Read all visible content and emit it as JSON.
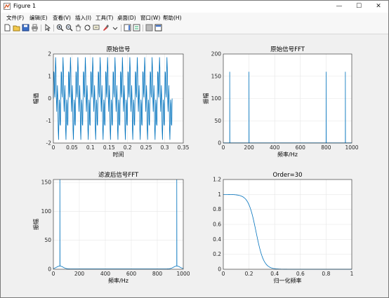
{
  "window": {
    "title": "Figure 1",
    "minimize": "—",
    "maximize": "☐",
    "close": "✕"
  },
  "menu": [
    "文件(F)",
    "编辑(E)",
    "查看(V)",
    "插入(I)",
    "工具(T)",
    "桌面(D)",
    "窗口(W)",
    "帮助(H)"
  ],
  "toolbar": {
    "icons": [
      "new-figure-icon",
      "open-file-icon",
      "save-icon",
      "print-icon",
      "pointer-icon",
      "zoom-in-icon",
      "zoom-out-icon",
      "pan-icon",
      "rotate-3d-icon",
      "data-cursor-icon",
      "brush-icon",
      "link-plot-icon",
      "insert-colorbar-icon",
      "insert-legend-icon",
      "hide-plot-tools-icon",
      "show-plot-tools-icon"
    ]
  },
  "colors": {
    "line": "#0072bd",
    "grid": "#e6e6e6",
    "axes": "#262626"
  },
  "chart_data": [
    {
      "type": "line",
      "title": "原始信号",
      "xlabel": "时间",
      "ylabel": "幅值",
      "xlim": [
        0,
        0.35
      ],
      "ylim": [
        -2,
        2
      ],
      "xticks": [
        "0",
        "0.05",
        "0.1",
        "0.15",
        "0.2",
        "0.25",
        "0.3",
        "0.35"
      ],
      "yticks": [
        "-2",
        "-1",
        "0",
        "1",
        "2"
      ],
      "series": [
        {
          "description": "sum of 50 Hz and 200 Hz sinusoids, sampled 1000 Hz, duration ~0.32 s",
          "x_end": 0.32,
          "amplitude_max": 1.9
        }
      ],
      "grid": true
    },
    {
      "type": "line",
      "title": "原始信号FFT",
      "xlabel": "频率/Hz",
      "ylabel": "振幅",
      "xlim": [
        0,
        1000
      ],
      "ylim": [
        0,
        200
      ],
      "xticks": [
        "0",
        "200",
        "400",
        "600",
        "800",
        "1000"
      ],
      "yticks": [
        "0",
        "50",
        "100",
        "150",
        "200"
      ],
      "peaks": [
        {
          "x": 50,
          "y": 160
        },
        {
          "x": 200,
          "y": 160
        },
        {
          "x": 800,
          "y": 160
        },
        {
          "x": 950,
          "y": 160
        }
      ],
      "grid": true
    },
    {
      "type": "line",
      "title": "滤波后信号FFT",
      "xlabel": "频率/Hz",
      "ylabel": "振幅",
      "xlim": [
        0,
        1000
      ],
      "ylim": [
        0,
        155
      ],
      "xticks": [
        "0",
        "200",
        "400",
        "600",
        "800",
        "1000"
      ],
      "yticks": [
        "0",
        "50",
        "100",
        "150"
      ],
      "peaks": [
        {
          "x": 50,
          "y": 155
        },
        {
          "x": 950,
          "y": 155
        }
      ],
      "grid": true
    },
    {
      "type": "line",
      "title": "Order=30",
      "xlabel": "归一化频率",
      "ylabel": "",
      "xlim": [
        0,
        1
      ],
      "ylim": [
        0,
        1.2
      ],
      "xticks": [
        "0",
        "0.2",
        "0.4",
        "0.6",
        "0.8",
        "1"
      ],
      "yticks": [
        "0",
        "0.2",
        "0.4",
        "0.6",
        "0.8",
        "1",
        "1.2"
      ],
      "series": [
        {
          "description": "low-pass magnitude response, passband 1 until ~0.15, cutoff ~0.25, stopband 0 after ~0.4"
        }
      ],
      "grid": true
    }
  ]
}
